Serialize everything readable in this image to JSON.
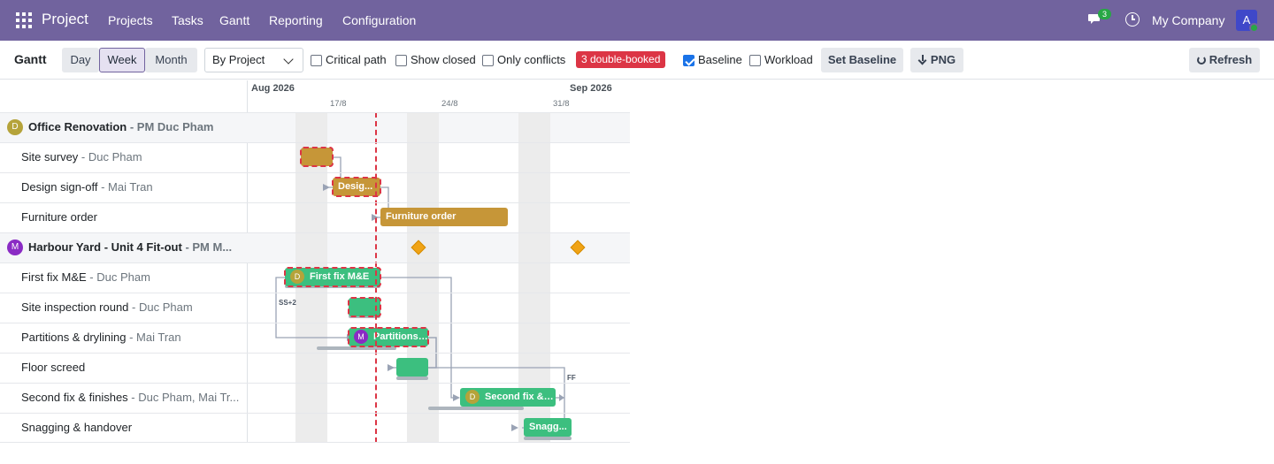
{
  "topbar": {
    "app_title": "Project",
    "menu": [
      "Projects",
      "Tasks",
      "Gantt",
      "Reporting",
      "Configuration"
    ],
    "chat_count": "3",
    "company": "My Company",
    "avatar_letter": "A"
  },
  "control": {
    "title": "Gantt",
    "scales": [
      "Day",
      "Week",
      "Month"
    ],
    "active_scale": "Week",
    "group_by": "By Project",
    "critical_path": "Critical path",
    "show_closed": "Show closed",
    "only_conflicts": "Only conflicts",
    "conflict_badge": "3 double-booked",
    "baseline": "Baseline",
    "baseline_checked": true,
    "workload": "Workload",
    "set_baseline": "Set Baseline",
    "png": "PNG",
    "refresh": "Refresh"
  },
  "timeline": {
    "months": [
      "Aug 2026",
      "Sep 2026"
    ],
    "ticks": [
      "17/8",
      "24/8",
      "31/8"
    ]
  },
  "rows": [
    {
      "type": "group",
      "avatar": "D",
      "avatar_color": "#b5a33a",
      "name": "Office Renovation",
      "pm": " - PM Duc Pham"
    },
    {
      "type": "task",
      "name": "Site survey",
      "assignee": " - Duc Pham"
    },
    {
      "type": "task",
      "name": "Design sign-off",
      "assignee": " - Mai Tran"
    },
    {
      "type": "task",
      "name": "Furniture order",
      "assignee": ""
    },
    {
      "type": "group",
      "avatar": "M",
      "avatar_color": "#8a2bc4",
      "name": "Harbour Yard - Unit 4 Fit-out",
      "pm": " - PM M..."
    },
    {
      "type": "task",
      "name": "First fix M&E",
      "assignee": " - Duc Pham"
    },
    {
      "type": "task",
      "name": "Site inspection round",
      "assignee": " - Duc Pham"
    },
    {
      "type": "task",
      "name": "Partitions & drylining",
      "assignee": " - Mai Tran"
    },
    {
      "type": "task",
      "name": "Floor screed",
      "assignee": ""
    },
    {
      "type": "task",
      "name": "Second fix & finishes",
      "assignee": " - Duc Pham, Mai Tr..."
    },
    {
      "type": "task",
      "name": "Snagging & handover",
      "assignee": ""
    }
  ],
  "bars": {
    "site_survey": "",
    "design_signoff": "Desig...",
    "furniture_order": "Furniture order",
    "first_fix": "First fix M&E",
    "first_fix_avatar": "D",
    "site_inspection": "",
    "partitions": "Partitions ...",
    "partitions_avatar": "M",
    "floor_screed": "",
    "second_fix": "Second fix & f...",
    "second_fix_avatar": "D",
    "snagging": "Snagg..."
  },
  "dependency_labels": {
    "ss": "SS+2",
    "ff": "FF"
  }
}
